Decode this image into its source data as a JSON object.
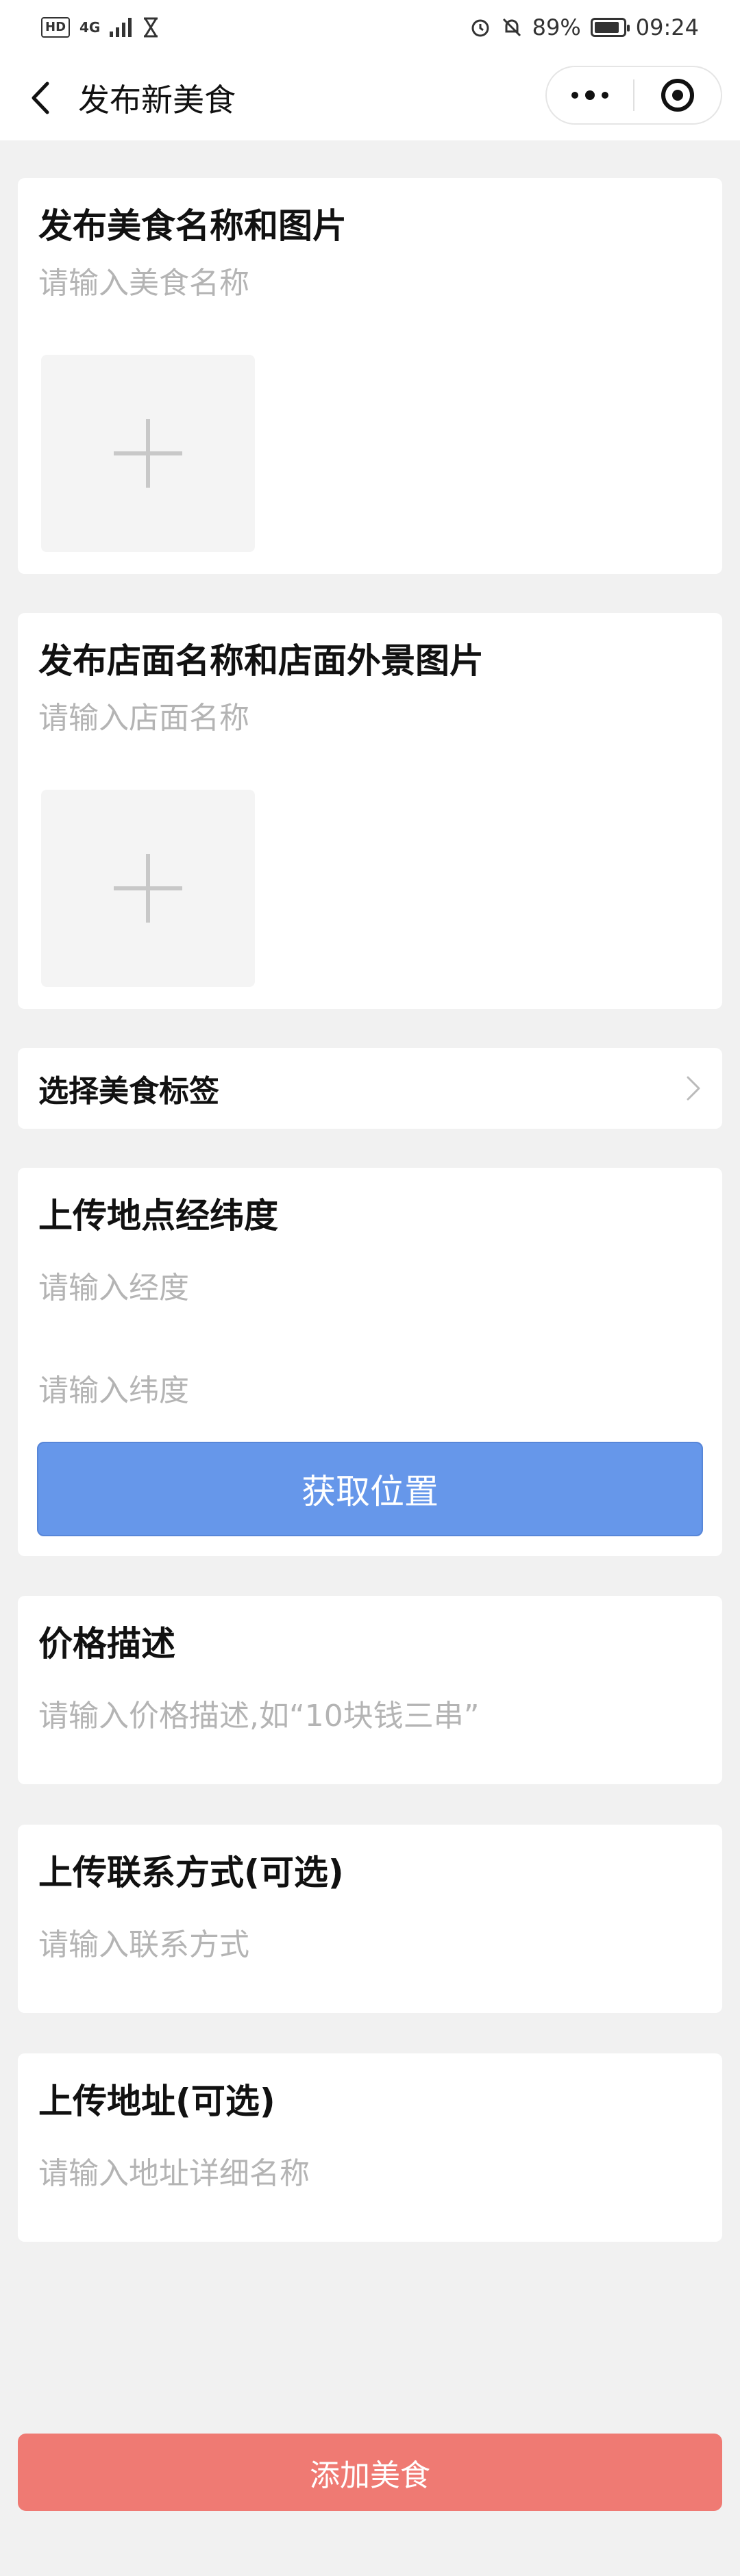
{
  "status_bar": {
    "hd_badge": "HD",
    "network": "4G",
    "battery_percent": "89%",
    "battery_level": 0.89,
    "time": "09:24",
    "icons": [
      "alarm-icon",
      "mute-icon",
      "hourglass-icon"
    ]
  },
  "navbar": {
    "title": "发布新美食",
    "back_icon": "chevron-left-icon",
    "more_icon": "more-dots-icon",
    "close_icon": "target-icon"
  },
  "food_section": {
    "title": "发布美食名称和图片",
    "name_placeholder": "请输入美食名称",
    "name_value": ""
  },
  "shop_section": {
    "title": "发布店面名称和店面外景图片",
    "name_placeholder": "请输入店面名称",
    "name_value": ""
  },
  "tag_row": {
    "label": "选择美食标签"
  },
  "location_section": {
    "title": "上传地点经纬度",
    "longitude_placeholder": "请输入经度",
    "latitude_placeholder": "请输入纬度",
    "button_label": "获取位置"
  },
  "price_section": {
    "title": "价格描述",
    "placeholder": "请输入价格描述,如“10块钱三串”"
  },
  "contact_section": {
    "title": "上传联系方式(可选)",
    "placeholder": "请输入联系方式"
  },
  "address_section": {
    "title": "上传地址(可选)",
    "placeholder": "请输入地址详细名称"
  },
  "submit": {
    "label": "添加美食"
  },
  "colors": {
    "background": "#f1f1f1",
    "primary_button": "#6697ea",
    "submit_button": "#ef7a73",
    "placeholder": "#b4b4b4"
  }
}
